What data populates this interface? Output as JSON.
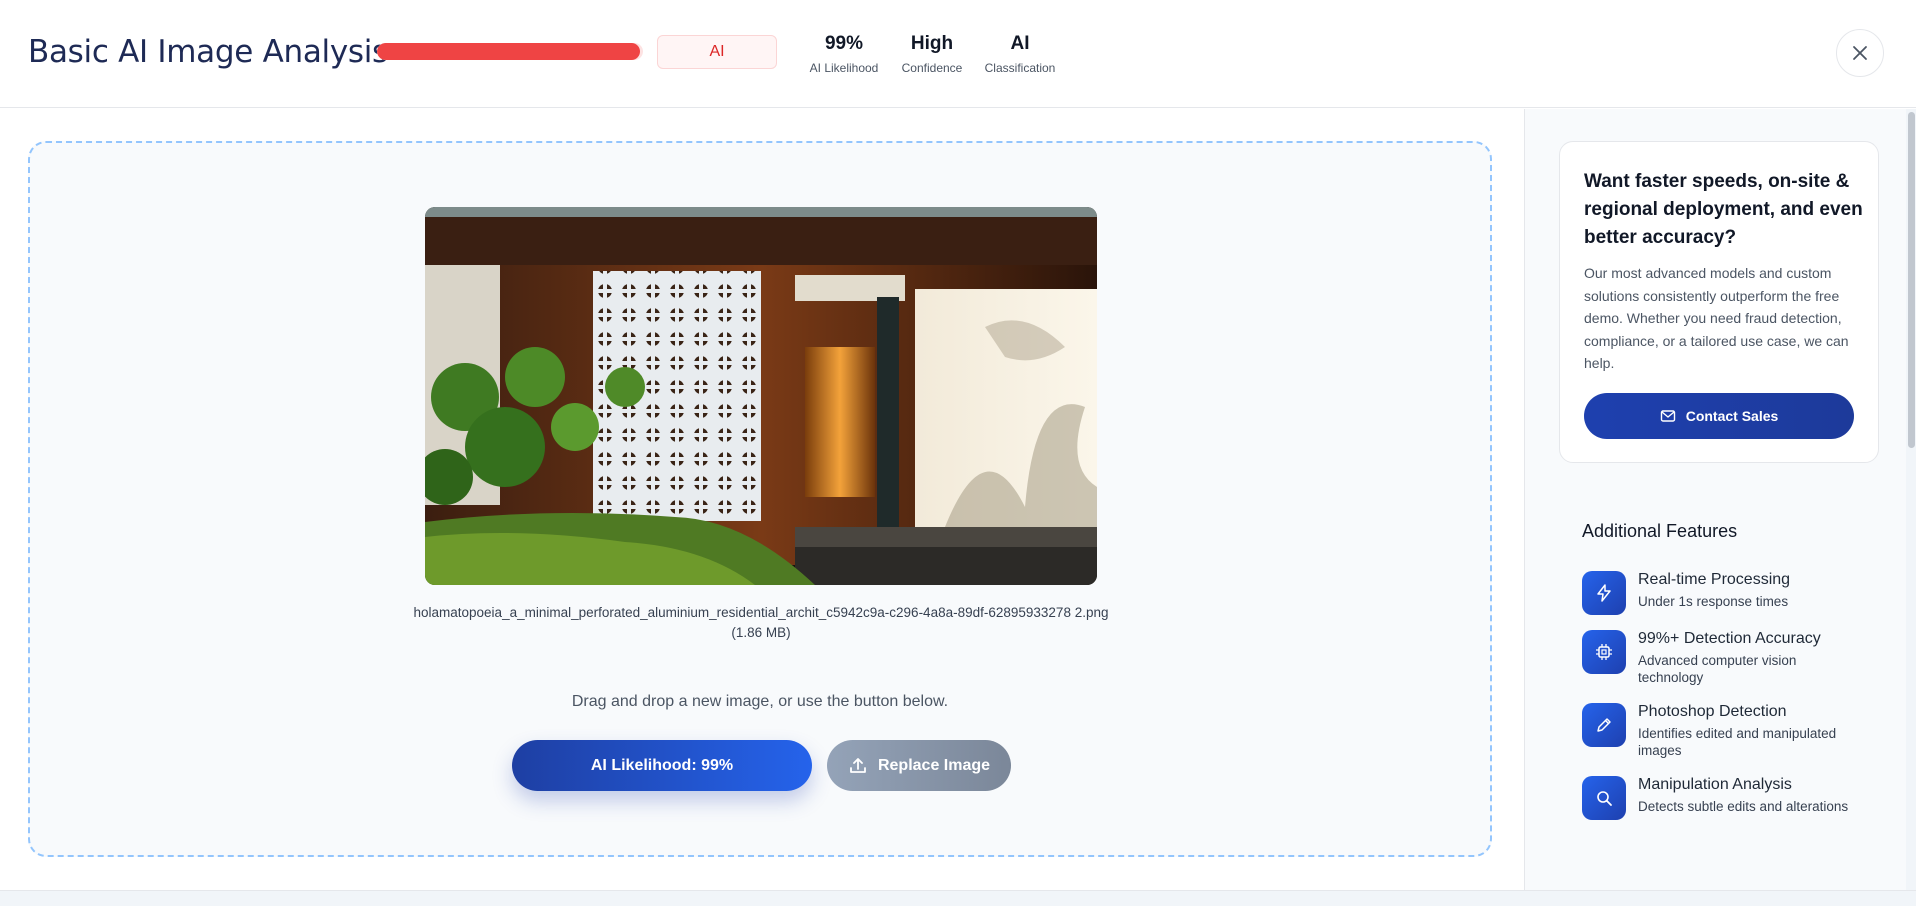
{
  "header": {
    "title": "Basic AI Image Analysis",
    "likelihood_fraction": 0.99,
    "bar_color": "#ef4444",
    "badge": "AI",
    "stats": [
      {
        "value": "99%",
        "label": "AI Likelihood"
      },
      {
        "value": "High",
        "label": "Confidence"
      },
      {
        "value": "AI",
        "label": "Classification"
      }
    ],
    "close_icon": "close-icon"
  },
  "main": {
    "filename": "holamatopoeia_a_minimal_perforated_aluminium_residential_archit_c5942c9a-c296-4a8a-89df-62895933278 2.png (1.86 MB)",
    "hint": "Drag and drop a new image, or use the button below.",
    "primary_button": "AI Likelihood: 99%",
    "replace_button": "Replace Image",
    "replace_icon": "upload-icon"
  },
  "sidebar": {
    "promo_title": "Want faster speeds, on-site & regional deployment, and even better accuracy?",
    "promo_text": "Our most advanced models and custom solutions consistently outperform the free demo. Whether you need fraud detection, compliance, or a tailored use case, we can help.",
    "contact_button": "Contact Sales",
    "features_title": "Additional Features",
    "features": [
      {
        "icon": "lightning-icon",
        "title": "Real-time Processing",
        "desc": "Under 1s response times"
      },
      {
        "icon": "chip-icon",
        "title": "99%+ Detection Accuracy",
        "desc": "Advanced computer vision technology"
      },
      {
        "icon": "pencil-icon",
        "title": "Photoshop Detection",
        "desc": "Identifies edited and manipulated images"
      },
      {
        "icon": "search-icon",
        "title": "Manipulation Analysis",
        "desc": "Detects subtle edits and alterations"
      }
    ]
  },
  "colors": {
    "accent": "#2563eb",
    "danger": "#ef4444",
    "title": "#1e2a55"
  }
}
